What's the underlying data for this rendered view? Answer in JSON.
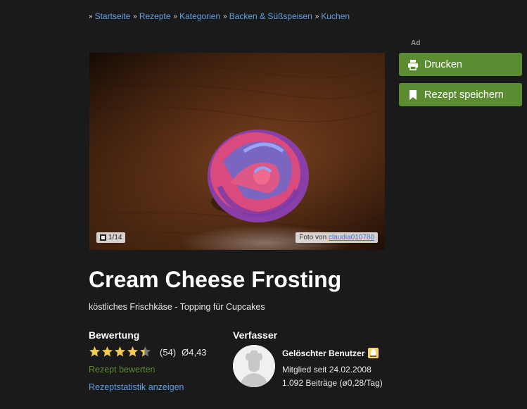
{
  "breadcrumb": [
    {
      "label": "Startseite"
    },
    {
      "label": "Rezepte"
    },
    {
      "label": "Kategorien"
    },
    {
      "label": "Backen & Süßspeisen"
    },
    {
      "label": "Kuchen"
    }
  ],
  "sidebar": {
    "ad_label": "Ad",
    "print_label": "Drucken",
    "save_label": "Rezept speichern"
  },
  "photo": {
    "counter": "1/14",
    "credit_prefix": "Foto von",
    "credit_user": "claudia010780"
  },
  "recipe": {
    "title": "Cream Cheese Frosting",
    "subtitle": "köstliches Frischkäse - Topping für Cupcakes"
  },
  "rating": {
    "heading": "Bewertung",
    "count": "(54)",
    "average": "Ø4,43",
    "stars_value": 4.43,
    "stars_max": 5,
    "rate_link": "Rezept bewerten",
    "stats_link": "Rezeptstatistik anzeigen"
  },
  "author": {
    "heading": "Verfasser",
    "name": "Gelöschter Benutzer",
    "member_since": "Mitglied seit 24.02.2008",
    "posts": "1.092 Beiträge (ø0,28/Tag)"
  },
  "colors": {
    "accent_green": "#5b8c32",
    "link_blue": "#5e9fe6",
    "background": "#1a1a1a",
    "star": "#f2c94c"
  }
}
